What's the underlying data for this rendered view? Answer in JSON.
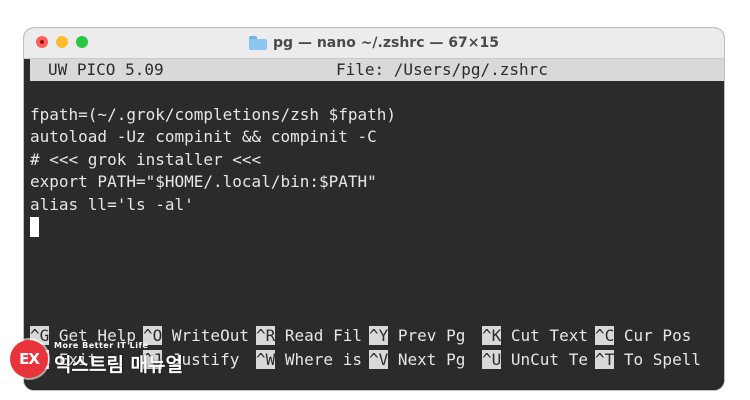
{
  "window": {
    "title": "pg — nano ~/.zshrc — 67×15"
  },
  "editor": {
    "app_version": "UW PICO 5.09",
    "file_label": "File: /Users/pg/.zshrc",
    "lines": [
      "",
      "fpath=(~/.grok/completions/zsh $fpath)",
      "autoload -Uz compinit && compinit -C",
      "# <<< grok installer <<<",
      "export PATH=\"$HOME/.local/bin:$PATH\"",
      "alias ll='ls -al'"
    ]
  },
  "shortcuts": {
    "row1": [
      {
        "key": "^G",
        "label": " Get Help"
      },
      {
        "key": "^O",
        "label": " WriteOut"
      },
      {
        "key": "^R",
        "label": " Read Fil"
      },
      {
        "key": "^Y",
        "label": " Prev Pg"
      },
      {
        "key": "^K",
        "label": " Cut Text"
      },
      {
        "key": "^C",
        "label": " Cur Pos"
      }
    ],
    "row2": [
      {
        "key": "^X",
        "label": " Exit"
      },
      {
        "key": "^J",
        "label": " Justify"
      },
      {
        "key": "^W",
        "label": " Where is"
      },
      {
        "key": "^V",
        "label": " Next Pg"
      },
      {
        "key": "^U",
        "label": " UnCut Te"
      },
      {
        "key": "^T",
        "label": " To Spell"
      }
    ]
  },
  "watermark": {
    "logo_text": "EX",
    "tagline": "More Better IT Life",
    "name": "익스트림 매뉴얼"
  }
}
